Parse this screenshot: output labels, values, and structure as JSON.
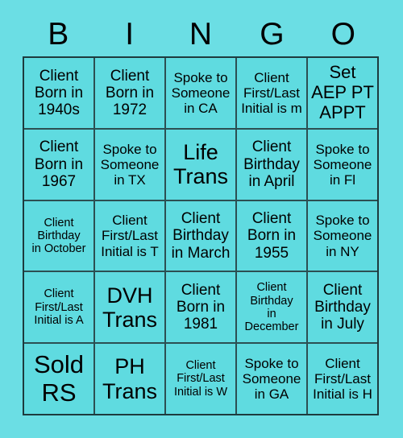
{
  "card": {
    "title_letters": [
      "B",
      "I",
      "N",
      "G",
      "O"
    ],
    "background_color": "#6bdee4",
    "cell_color": "#5fdbe0",
    "border_color": "#1d3b3e",
    "text_color": "#000000"
  },
  "grid": {
    "columns": 5,
    "rows": 5,
    "cells": [
      {
        "text": "Client\nBorn in\n1940s",
        "size": "m"
      },
      {
        "text": "Client\nBorn in\n1972",
        "size": "m"
      },
      {
        "text": "Spoke to\nSomeone\nin CA",
        "size": "s"
      },
      {
        "text": "Client\nFirst/Last\nInitial is m",
        "size": "s"
      },
      {
        "text": "Set\nAEP PT\nAPPT",
        "size": "l"
      },
      {
        "text": "Client\nBorn in\n1967",
        "size": "m"
      },
      {
        "text": "Spoke to\nSomeone\nin TX",
        "size": "s"
      },
      {
        "text": "Life\nTrans",
        "size": "xl"
      },
      {
        "text": "Client\nBirthday\nin April",
        "size": "m"
      },
      {
        "text": "Spoke to\nSomeone\nin Fl",
        "size": "s"
      },
      {
        "text": "Client\nBirthday\nin October",
        "size": "xs"
      },
      {
        "text": "Client\nFirst/Last\nInitial is T",
        "size": "s"
      },
      {
        "text": "Client\nBirthday\nin March",
        "size": "m"
      },
      {
        "text": "Client\nBorn in\n1955",
        "size": "m"
      },
      {
        "text": "Spoke to\nSomeone\nin NY",
        "size": "s"
      },
      {
        "text": "Client\nFirst/Last\nInitial is A",
        "size": "xs"
      },
      {
        "text": "DVH\nTrans",
        "size": "xl"
      },
      {
        "text": "Client\nBorn in\n1981",
        "size": "m"
      },
      {
        "text": "Client\nBirthday\nin\nDecember",
        "size": "xs"
      },
      {
        "text": "Client\nBirthday\nin July",
        "size": "m"
      },
      {
        "text": "Sold\nRS",
        "size": "xxl"
      },
      {
        "text": "PH\nTrans",
        "size": "xl"
      },
      {
        "text": "Client\nFirst/Last\nInitial is W",
        "size": "xs"
      },
      {
        "text": "Spoke to\nSomeone\nin GA",
        "size": "s"
      },
      {
        "text": "Client\nFirst/Last\nInitial is H",
        "size": "s"
      }
    ]
  }
}
